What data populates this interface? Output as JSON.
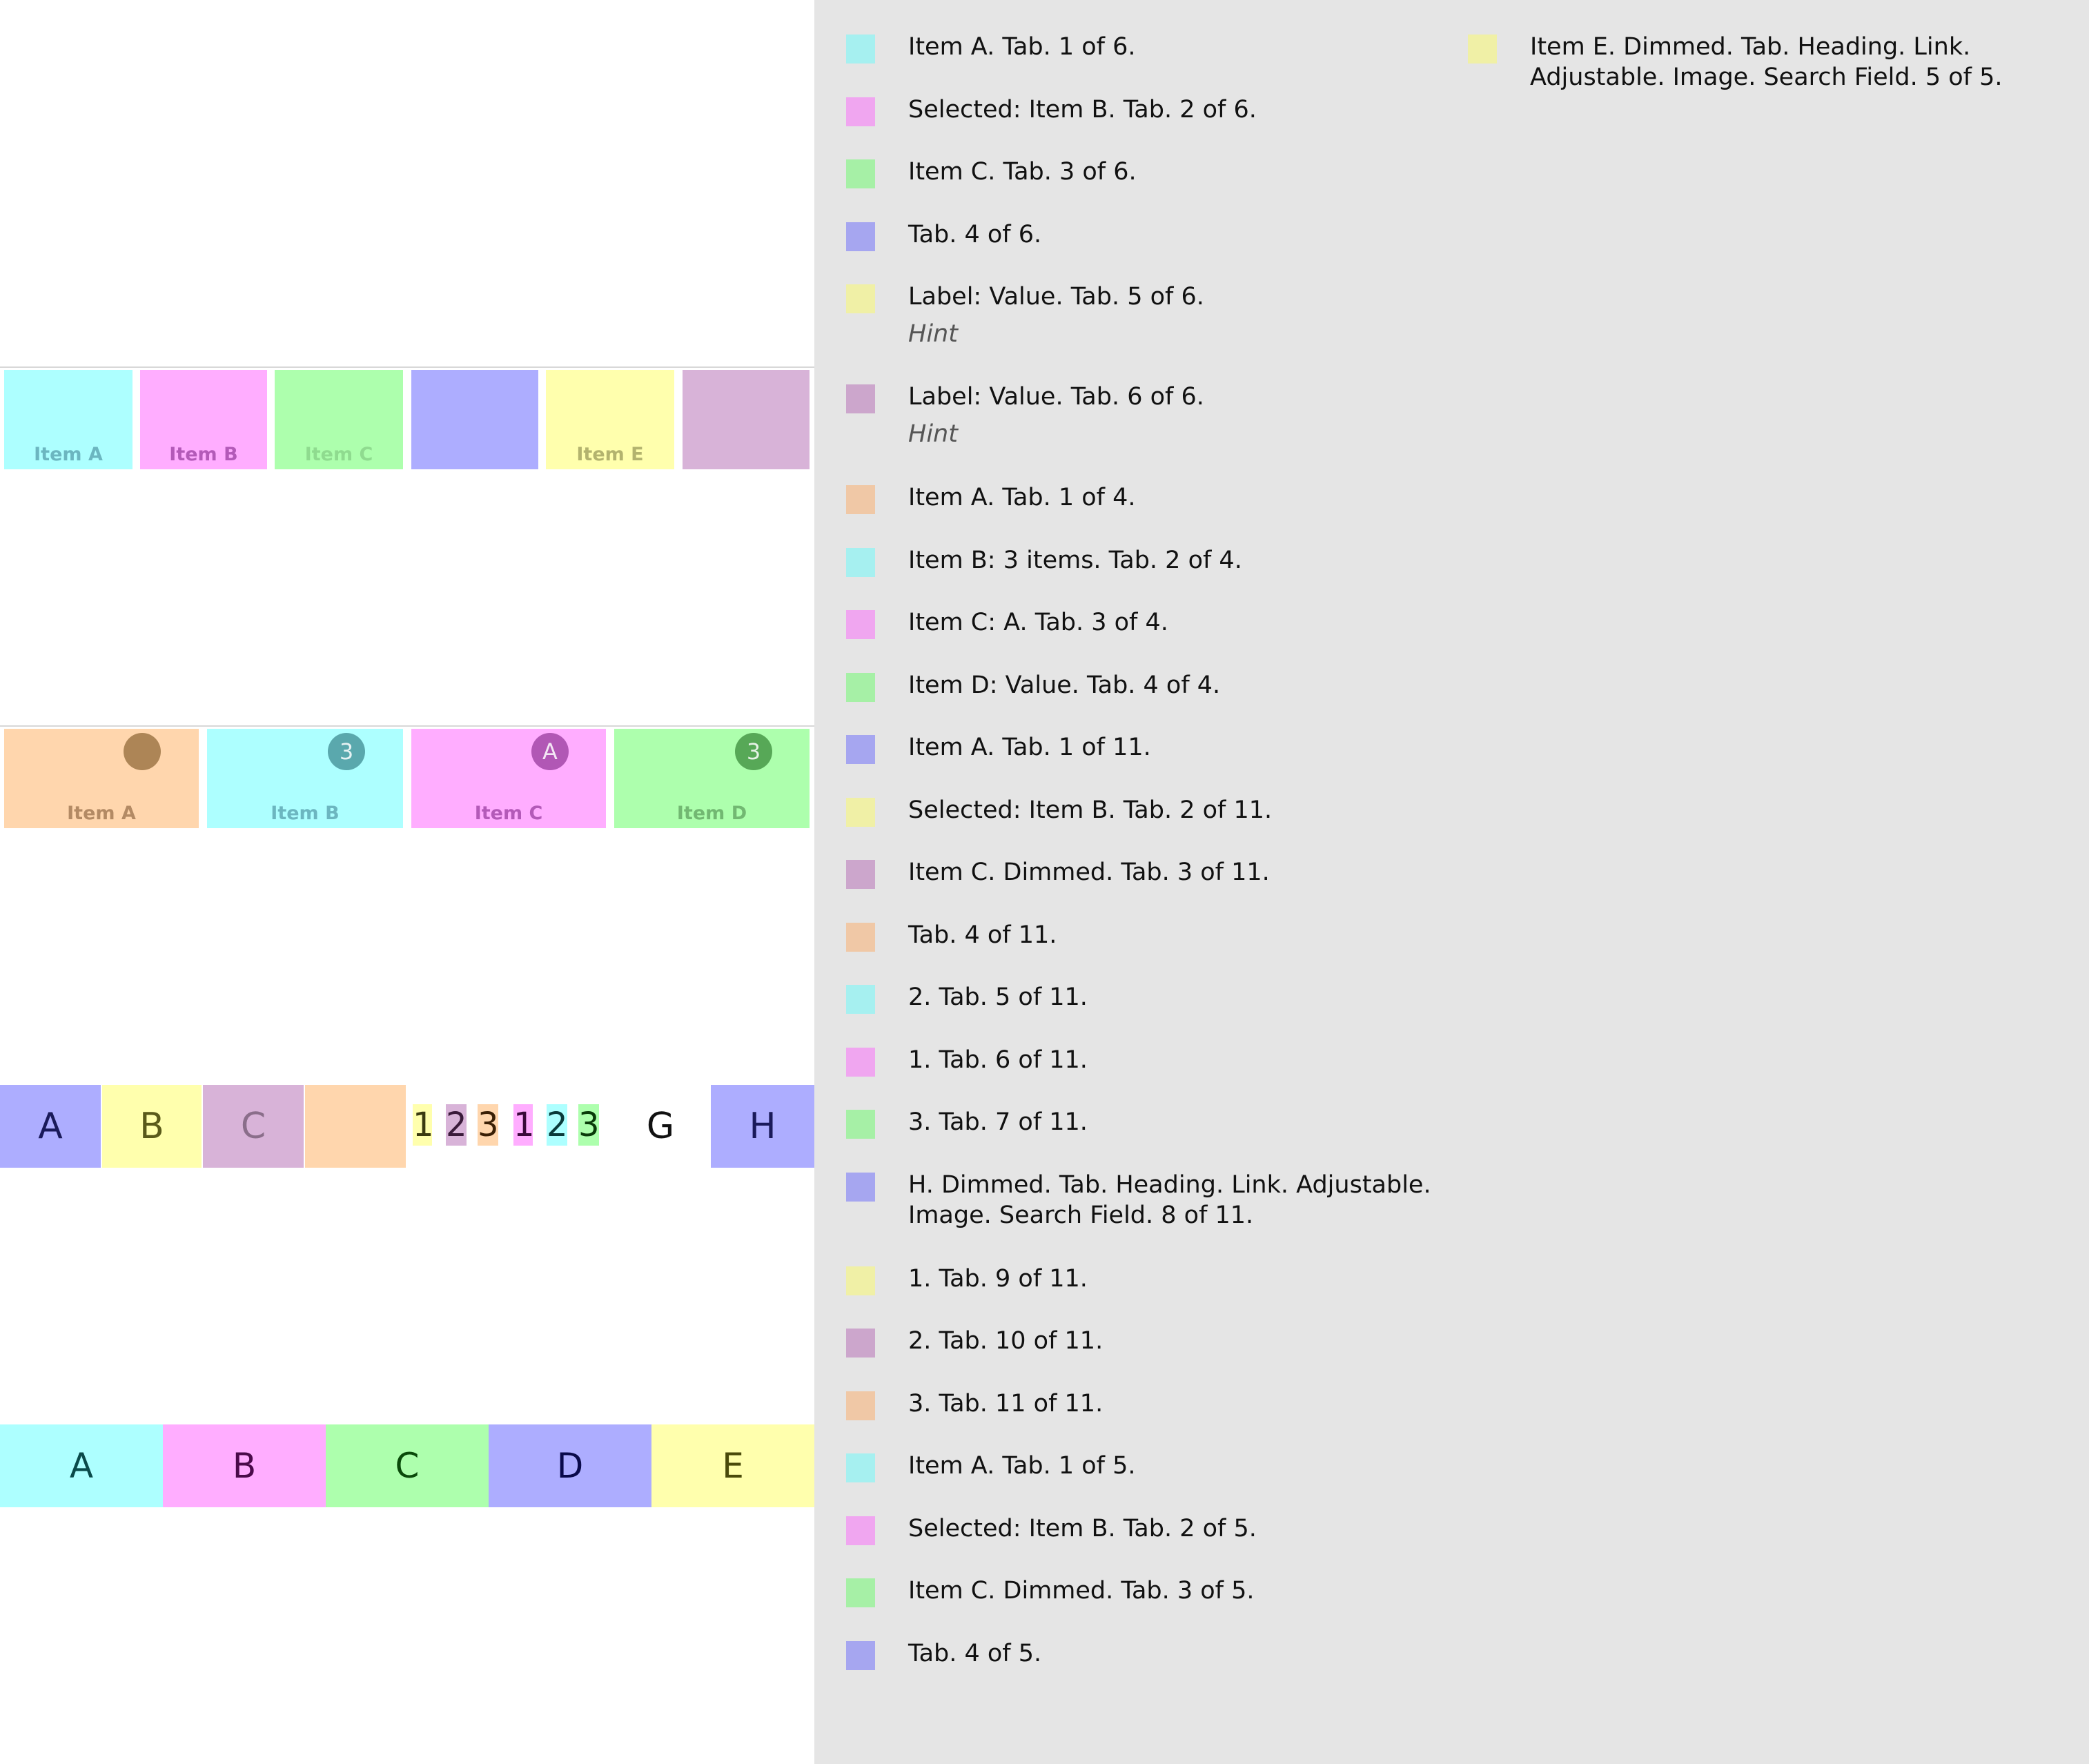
{
  "tabbar1": {
    "tabs": [
      {
        "label": "Item A",
        "bg": "#adffff",
        "fg": "#6cb6c0"
      },
      {
        "label": "Item B",
        "bg": "#ffadff",
        "fg": "#b35ab8"
      },
      {
        "label": "Item C",
        "bg": "#adffad",
        "fg": "#8fdb8f"
      },
      {
        "label": "",
        "bg": "#adadff",
        "fg": "#6b6bd0"
      },
      {
        "label": "Item E",
        "bg": "#ffffad",
        "fg": "#b3b36e"
      },
      {
        "label": "",
        "bg": "#d8b3d8",
        "fg": "#8f6b8f"
      }
    ]
  },
  "tabbar2": {
    "tabs": [
      {
        "label": "Item A",
        "badge": "",
        "bg": "#ffd6ad",
        "fg": "#b38a64",
        "badge_bg": "#ad8556"
      },
      {
        "label": "Item B",
        "badge": "3",
        "bg": "#adffff",
        "fg": "#6cb6c0",
        "badge_bg": "#5aa8ad"
      },
      {
        "label": "Item C",
        "badge": "A",
        "bg": "#ffadff",
        "fg": "#b35ab8",
        "badge_bg": "#b157b5"
      },
      {
        "label": "Item D",
        "badge": "3",
        "bg": "#adffad",
        "fg": "#72b872",
        "badge_bg": "#57a857"
      }
    ]
  },
  "tabbar3": {
    "big_tabs": [
      {
        "label": "A",
        "bg": "#adadff",
        "fg": "#1a1a5a"
      },
      {
        "label": "B",
        "bg": "#ffffad",
        "fg": "#5a5a1a"
      },
      {
        "label": "C",
        "bg": "#d8b3d8",
        "fg": "#8a6e8a"
      },
      {
        "label": "",
        "bg": "#ffd6ad",
        "fg": "#5a3a1a"
      }
    ],
    "mini_tabs": [
      {
        "label": "1",
        "bg": "#ffffad",
        "fg": "#3a3a10"
      },
      {
        "label": "2",
        "bg": "#d8b3d8",
        "fg": "#3a1a3a"
      },
      {
        "label": "3",
        "bg": "#ffd6ad",
        "fg": "#3a1f05"
      },
      {
        "label": "1",
        "bg": "#ffadff",
        "fg": "#3a0a3a"
      },
      {
        "label": "2",
        "bg": "#adffff",
        "fg": "#0a3a3a"
      },
      {
        "label": "3",
        "bg": "#adffad",
        "fg": "#0a3a0a"
      }
    ],
    "plain_tab": {
      "label": "G"
    },
    "last_tab": {
      "label": "H",
      "bg": "#adadff",
      "fg": "#1a1a5a"
    }
  },
  "tabbar4": {
    "tabs": [
      {
        "label": "A",
        "bg": "#adffff",
        "fg": "#0a4a4a"
      },
      {
        "label": "B",
        "bg": "#ffadff",
        "fg": "#4a0a4a"
      },
      {
        "label": "C",
        "bg": "#adffad",
        "fg": "#0a4a0a"
      },
      {
        "label": "D",
        "bg": "#adadff",
        "fg": "#0a0a4a"
      },
      {
        "label": "E",
        "bg": "#ffffad",
        "fg": "#4a4a0a"
      }
    ]
  },
  "accessibility_list": {
    "column1": [
      {
        "text": "Item A. Tab. 1 of 6.",
        "hint": "",
        "color": "#a6f0f0"
      },
      {
        "text": "Selected: Item B. Tab. 2 of 6.",
        "hint": "",
        "color": "#f0a6f0"
      },
      {
        "text": "Item C. Tab. 3 of 6.",
        "hint": "",
        "color": "#a6f0a6"
      },
      {
        "text": "Tab. 4 of 6.",
        "hint": "",
        "color": "#a6a6f0"
      },
      {
        "text": "Label: Value. Tab. 5 of 6.",
        "hint": "Hint",
        "color": "#f0f0a6"
      },
      {
        "text": "Label: Value. Tab. 6 of 6.",
        "hint": "Hint",
        "color": "#cca6cc"
      },
      {
        "text": "Item A. Tab. 1 of 4.",
        "hint": "",
        "color": "#f0c8a6"
      },
      {
        "text": "Item B: 3 items. Tab. 2 of 4.",
        "hint": "",
        "color": "#a6f0f0"
      },
      {
        "text": "Item C: A. Tab. 3 of 4.",
        "hint": "",
        "color": "#f0a6f0"
      },
      {
        "text": "Item D: Value. Tab. 4 of 4.",
        "hint": "",
        "color": "#a6f0a6"
      },
      {
        "text": "Item A. Tab. 1 of 11.",
        "hint": "",
        "color": "#a6a6f0"
      },
      {
        "text": "Selected: Item B. Tab. 2 of 11.",
        "hint": "",
        "color": "#f0f0a6"
      },
      {
        "text": "Item C. Dimmed. Tab. 3 of 11.",
        "hint": "",
        "color": "#cca6cc"
      },
      {
        "text": "Tab. 4 of 11.",
        "hint": "",
        "color": "#f0c8a6"
      },
      {
        "text": "2. Tab. 5 of 11.",
        "hint": "",
        "color": "#a6f0f0"
      },
      {
        "text": "1. Tab. 6 of 11.",
        "hint": "",
        "color": "#f0a6f0"
      },
      {
        "text": "3. Tab. 7 of 11.",
        "hint": "",
        "color": "#a6f0a6"
      },
      {
        "text": "H. Dimmed. Tab. Heading. Link. Adjustable.",
        "text2": "Image. Search Field. 8 of 11.",
        "hint": "",
        "color": "#a6a6f0"
      },
      {
        "text": "1. Tab. 9 of 11.",
        "hint": "",
        "color": "#f0f0a6"
      },
      {
        "text": "2. Tab. 10 of 11.",
        "hint": "",
        "color": "#cca6cc"
      },
      {
        "text": "3. Tab. 11 of 11.",
        "hint": "",
        "color": "#f0c8a6"
      },
      {
        "text": "Item A. Tab. 1 of 5.",
        "hint": "",
        "color": "#a6f0f0"
      },
      {
        "text": "Selected: Item B. Tab. 2 of 5.",
        "hint": "",
        "color": "#f0a6f0"
      },
      {
        "text": "Item C. Dimmed. Tab. 3 of 5.",
        "hint": "",
        "color": "#a6f0a6"
      },
      {
        "text": "Tab. 4 of 5.",
        "hint": "",
        "color": "#a6a6f0"
      }
    ],
    "column2": [
      {
        "text": "Item E. Dimmed. Tab. Heading. Link.",
        "text2": "Adjustable. Image. Search Field. 5 of 5.",
        "hint": "",
        "color": "#f0f0a6"
      }
    ]
  }
}
